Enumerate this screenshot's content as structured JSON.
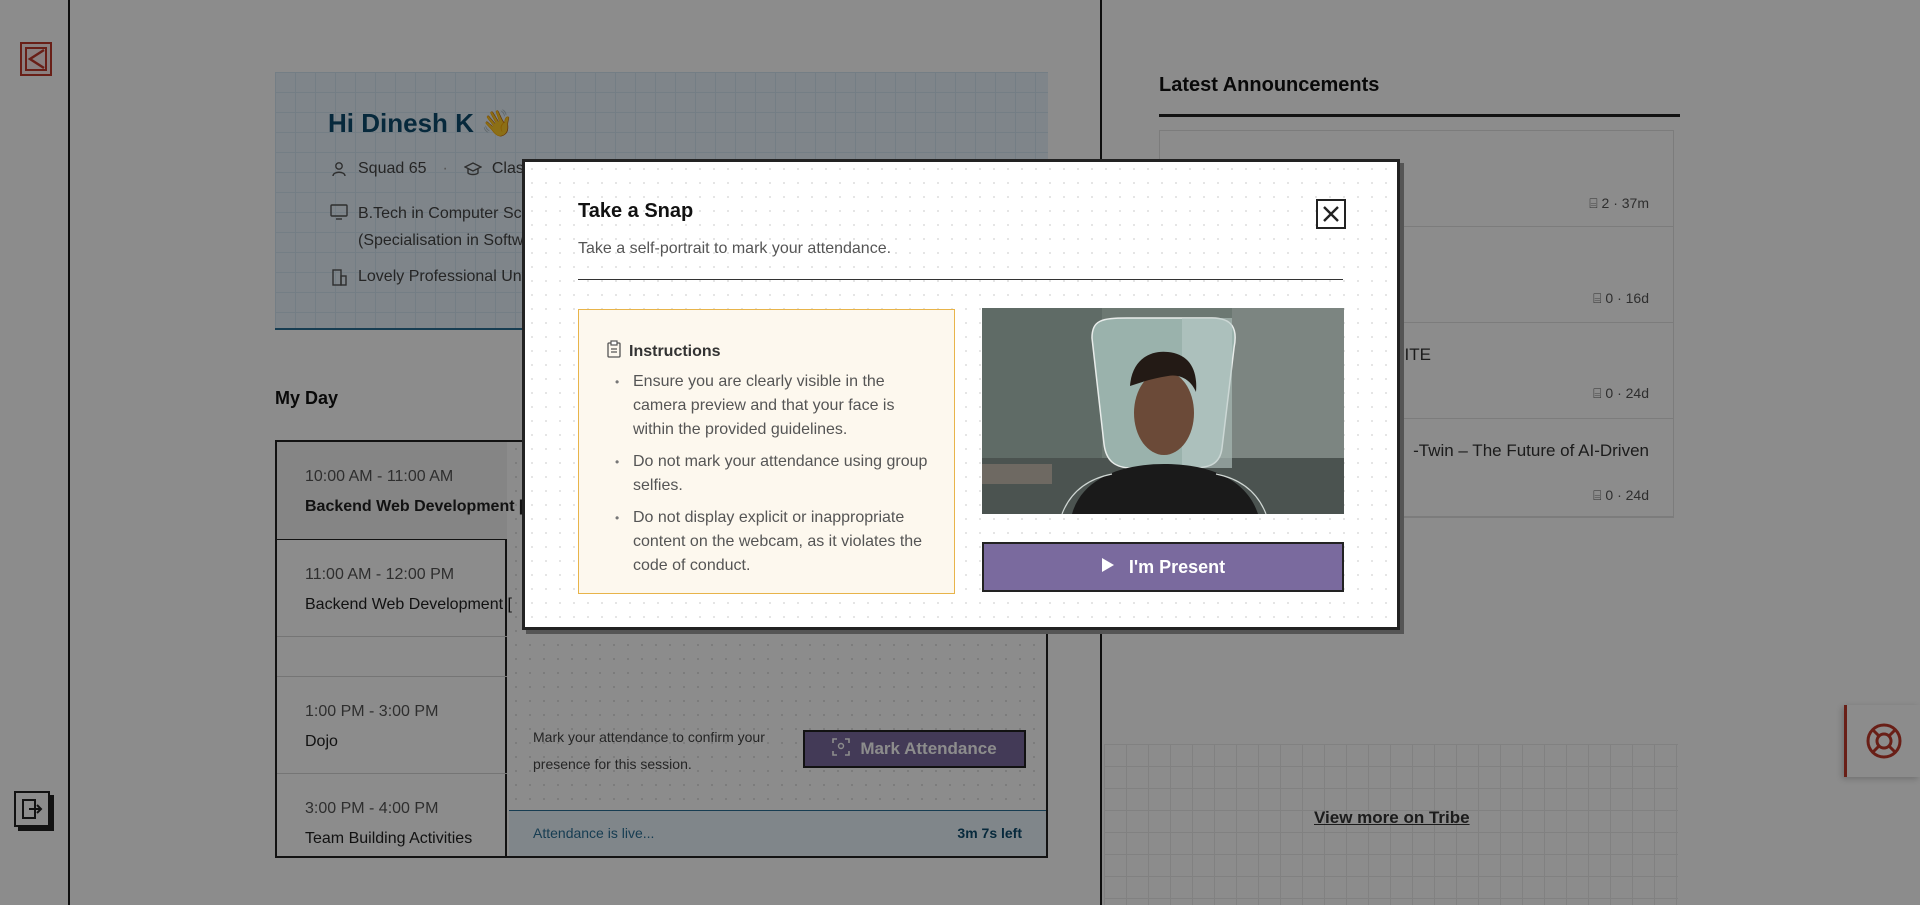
{
  "profile": {
    "greeting": "Hi Dinesh K 👋",
    "squad": "Squad 65",
    "class_partial": "Clas",
    "degree_line1": "B.Tech in Computer Sc",
    "degree_line2": "(Specialisation in Softw",
    "university": "Lovely Professional Uni"
  },
  "my_day": {
    "title": "My Day",
    "slots": [
      {
        "time": "10:00 AM - 11:00 AM",
        "name": "Backend Web Development [",
        "active": true
      },
      {
        "time": "11:00 AM - 12:00 PM",
        "name": "Backend Web Development [",
        "active": false
      },
      {
        "time": "",
        "name": "",
        "active": false
      },
      {
        "time": "1:00 PM - 3:00 PM",
        "name": "Dojo",
        "active": false
      },
      {
        "time": "3:00 PM - 4:00 PM",
        "name": "Team Building Activities",
        "active": false
      }
    ],
    "attendance_text": "Mark your attendance to confirm your presence for this session.",
    "mark_button": "Mark Attendance",
    "live_text": "Attendance is live...",
    "time_left": "3m 7s left"
  },
  "announcements": {
    "title": "Latest Announcements",
    "items": [
      {
        "title": "",
        "comments": "2",
        "age": "37m"
      },
      {
        "title": "",
        "comments": "0",
        "age": "16d"
      },
      {
        "title": "SITE",
        "comments": "0",
        "age": "24d"
      },
      {
        "title": "-Twin – The Future of AI-Driven",
        "comments": "0",
        "age": "24d"
      }
    ],
    "view_more": "View more on Tribe",
    "meta_separator": "·"
  },
  "modal": {
    "title": "Take a Snap",
    "subtitle": "Take a self-portrait to mark your attendance.",
    "instructions_title": "Instructions",
    "instructions": [
      "Ensure you are clearly visible in the camera preview and that your face is within the provided guidelines.",
      "Do not mark your attendance using group selfies.",
      "Do not display explicit or inappropriate content on the webcam, as it violates the code of conduct."
    ],
    "present_button": "I'm Present"
  },
  "colors": {
    "accent_purple": "#7a6a9e",
    "brand_red": "#c0392b",
    "info_blue": "#2a6f96",
    "instruction_bg": "#fdf8ee",
    "instruction_border": "#e8b44a"
  },
  "icons": {
    "logo": "logo-icon",
    "logout": "logout-icon",
    "close": "close-icon",
    "help": "lifebuoy-icon",
    "instructions": "clipboard-icon",
    "present": "play-icon"
  }
}
